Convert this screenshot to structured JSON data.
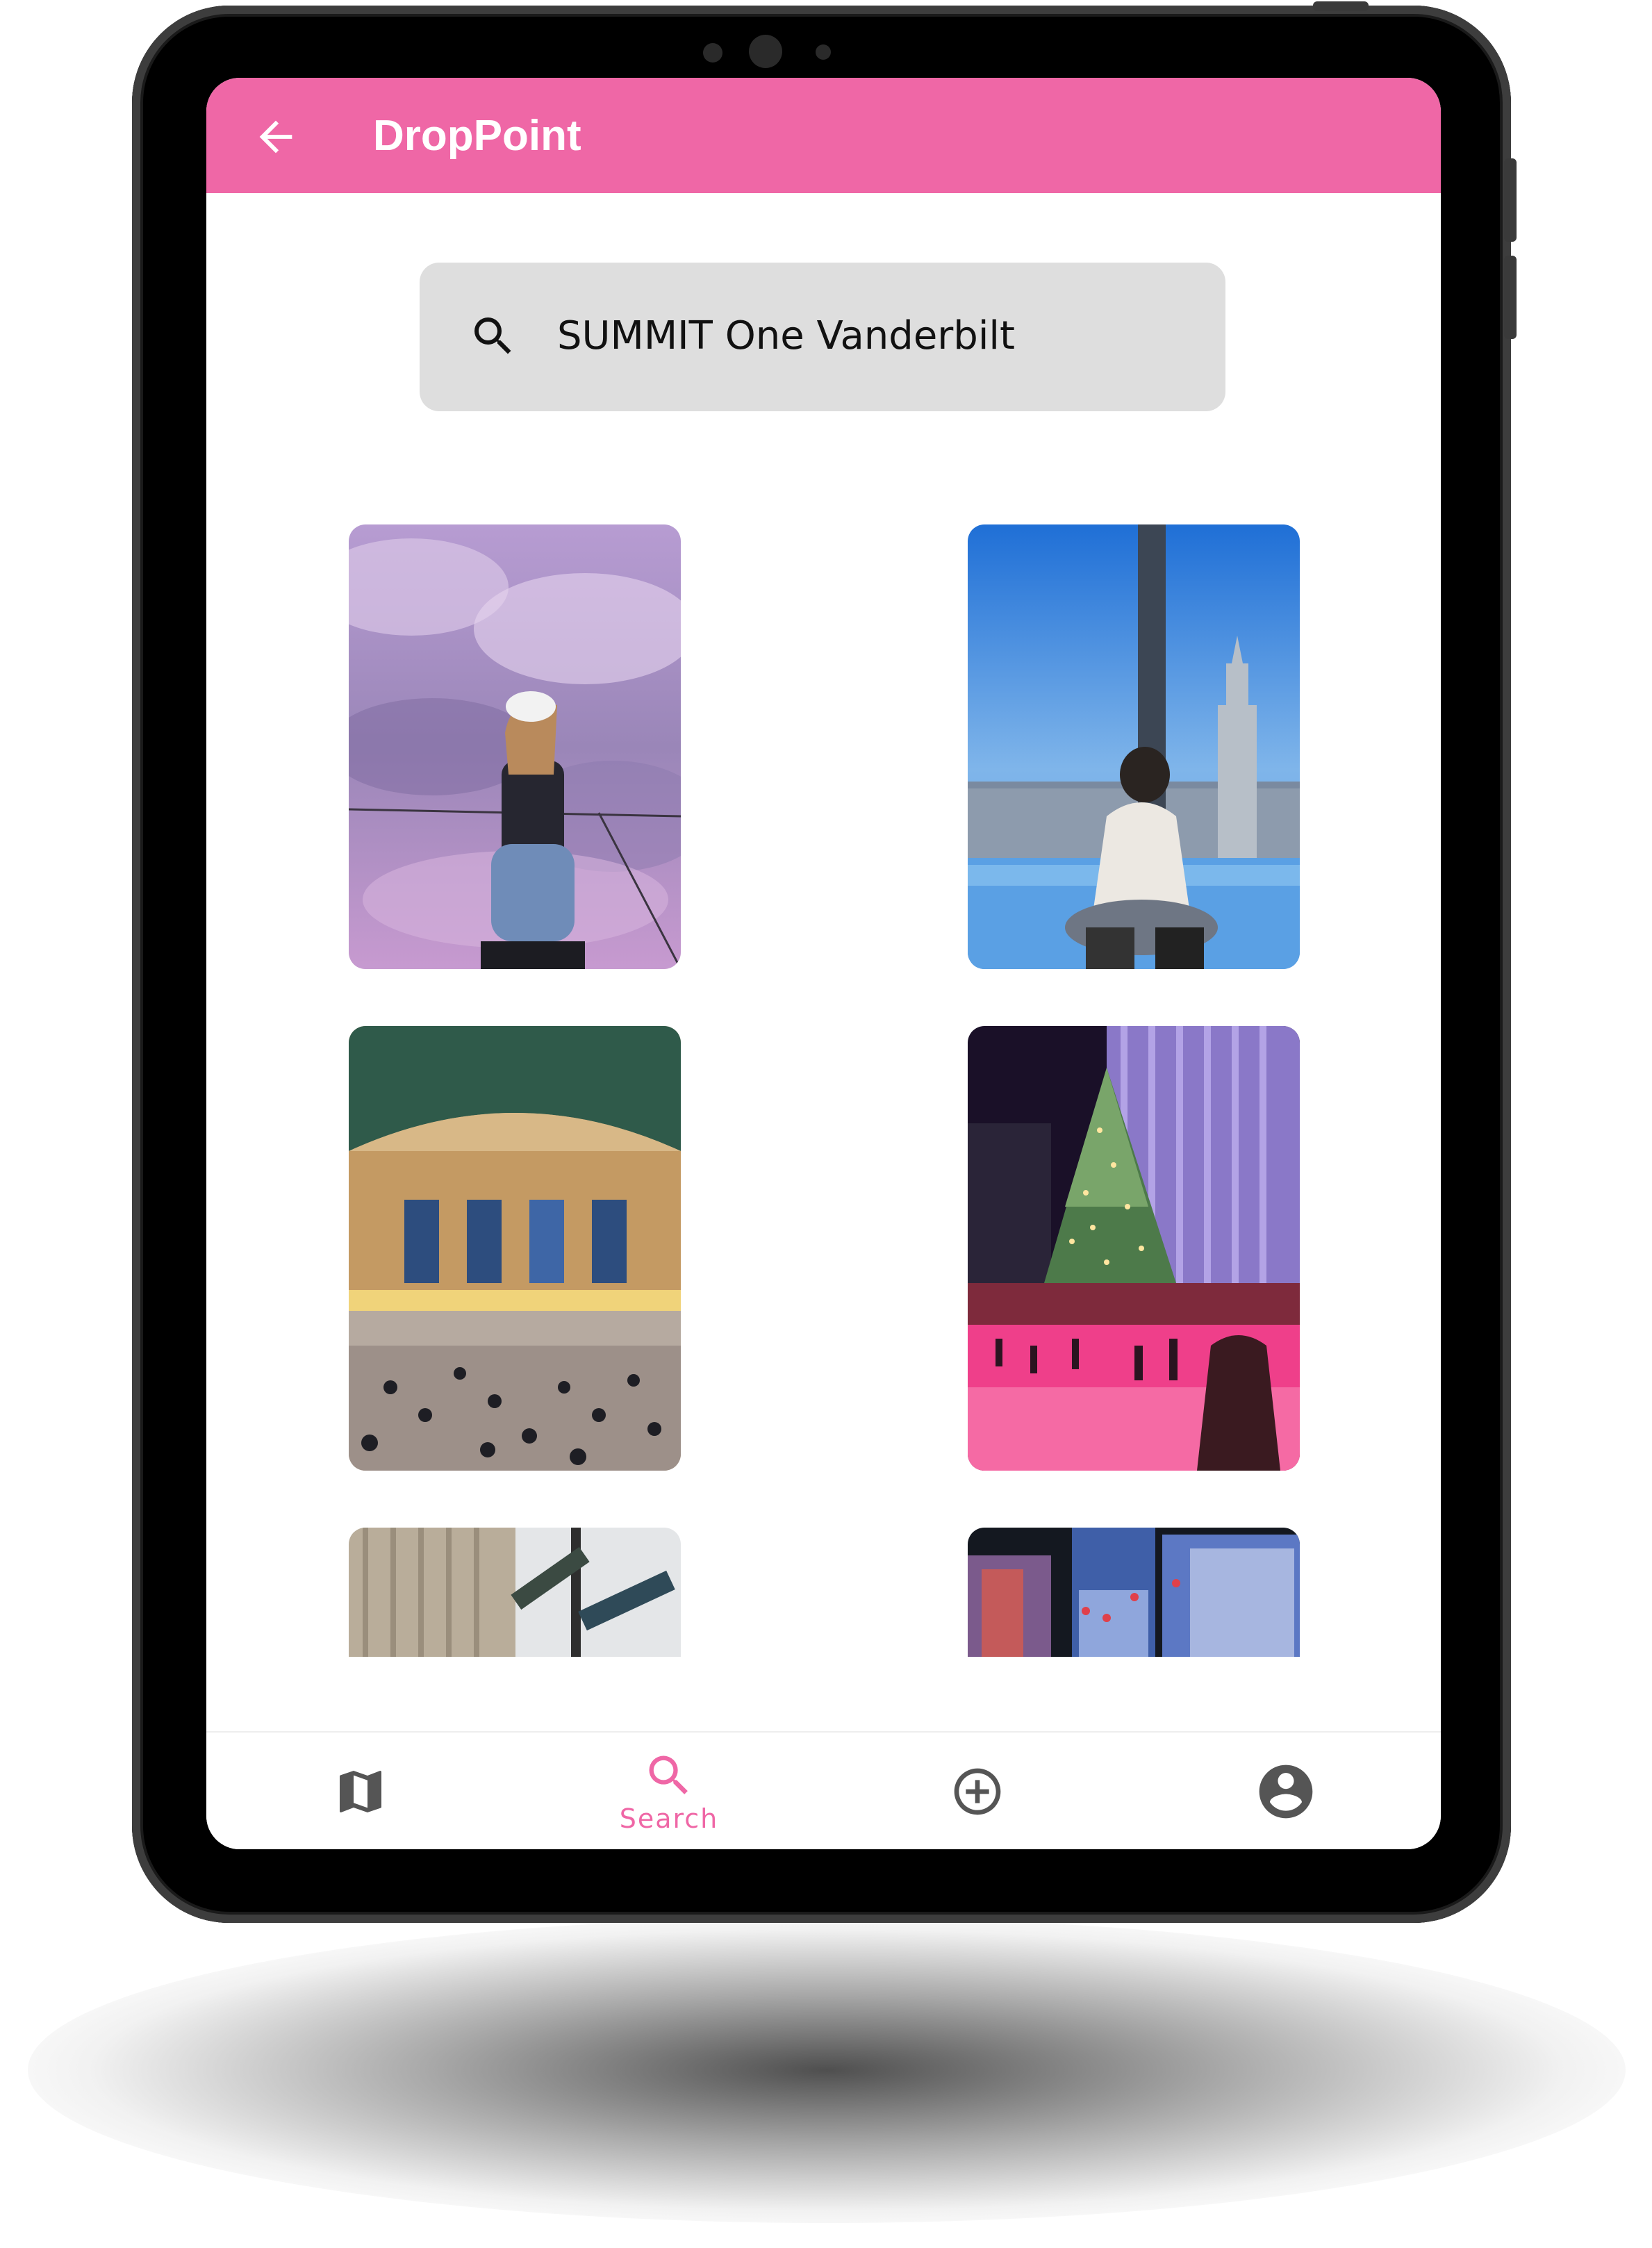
{
  "app": {
    "title": "DropPoint"
  },
  "search": {
    "query": "SUMMIT One Vanderbilt"
  },
  "results": [
    {
      "icon": "photo-woman-clouds"
    },
    {
      "icon": "photo-woman-skyline"
    },
    {
      "icon": "photo-grand-central"
    },
    {
      "icon": "photo-rockefeller-tree"
    },
    {
      "icon": "photo-street-sign"
    },
    {
      "icon": "photo-times-square"
    }
  ],
  "nav": {
    "items": [
      {
        "icon": "map-icon",
        "label": ""
      },
      {
        "icon": "search-icon",
        "label": "Search"
      },
      {
        "icon": "add-circle-icon",
        "label": ""
      },
      {
        "icon": "account-icon",
        "label": ""
      }
    ],
    "active_index": 1
  },
  "colors": {
    "accent": "#ef67a6",
    "search_background": "#dedede",
    "inactive_icon": "#555555"
  }
}
